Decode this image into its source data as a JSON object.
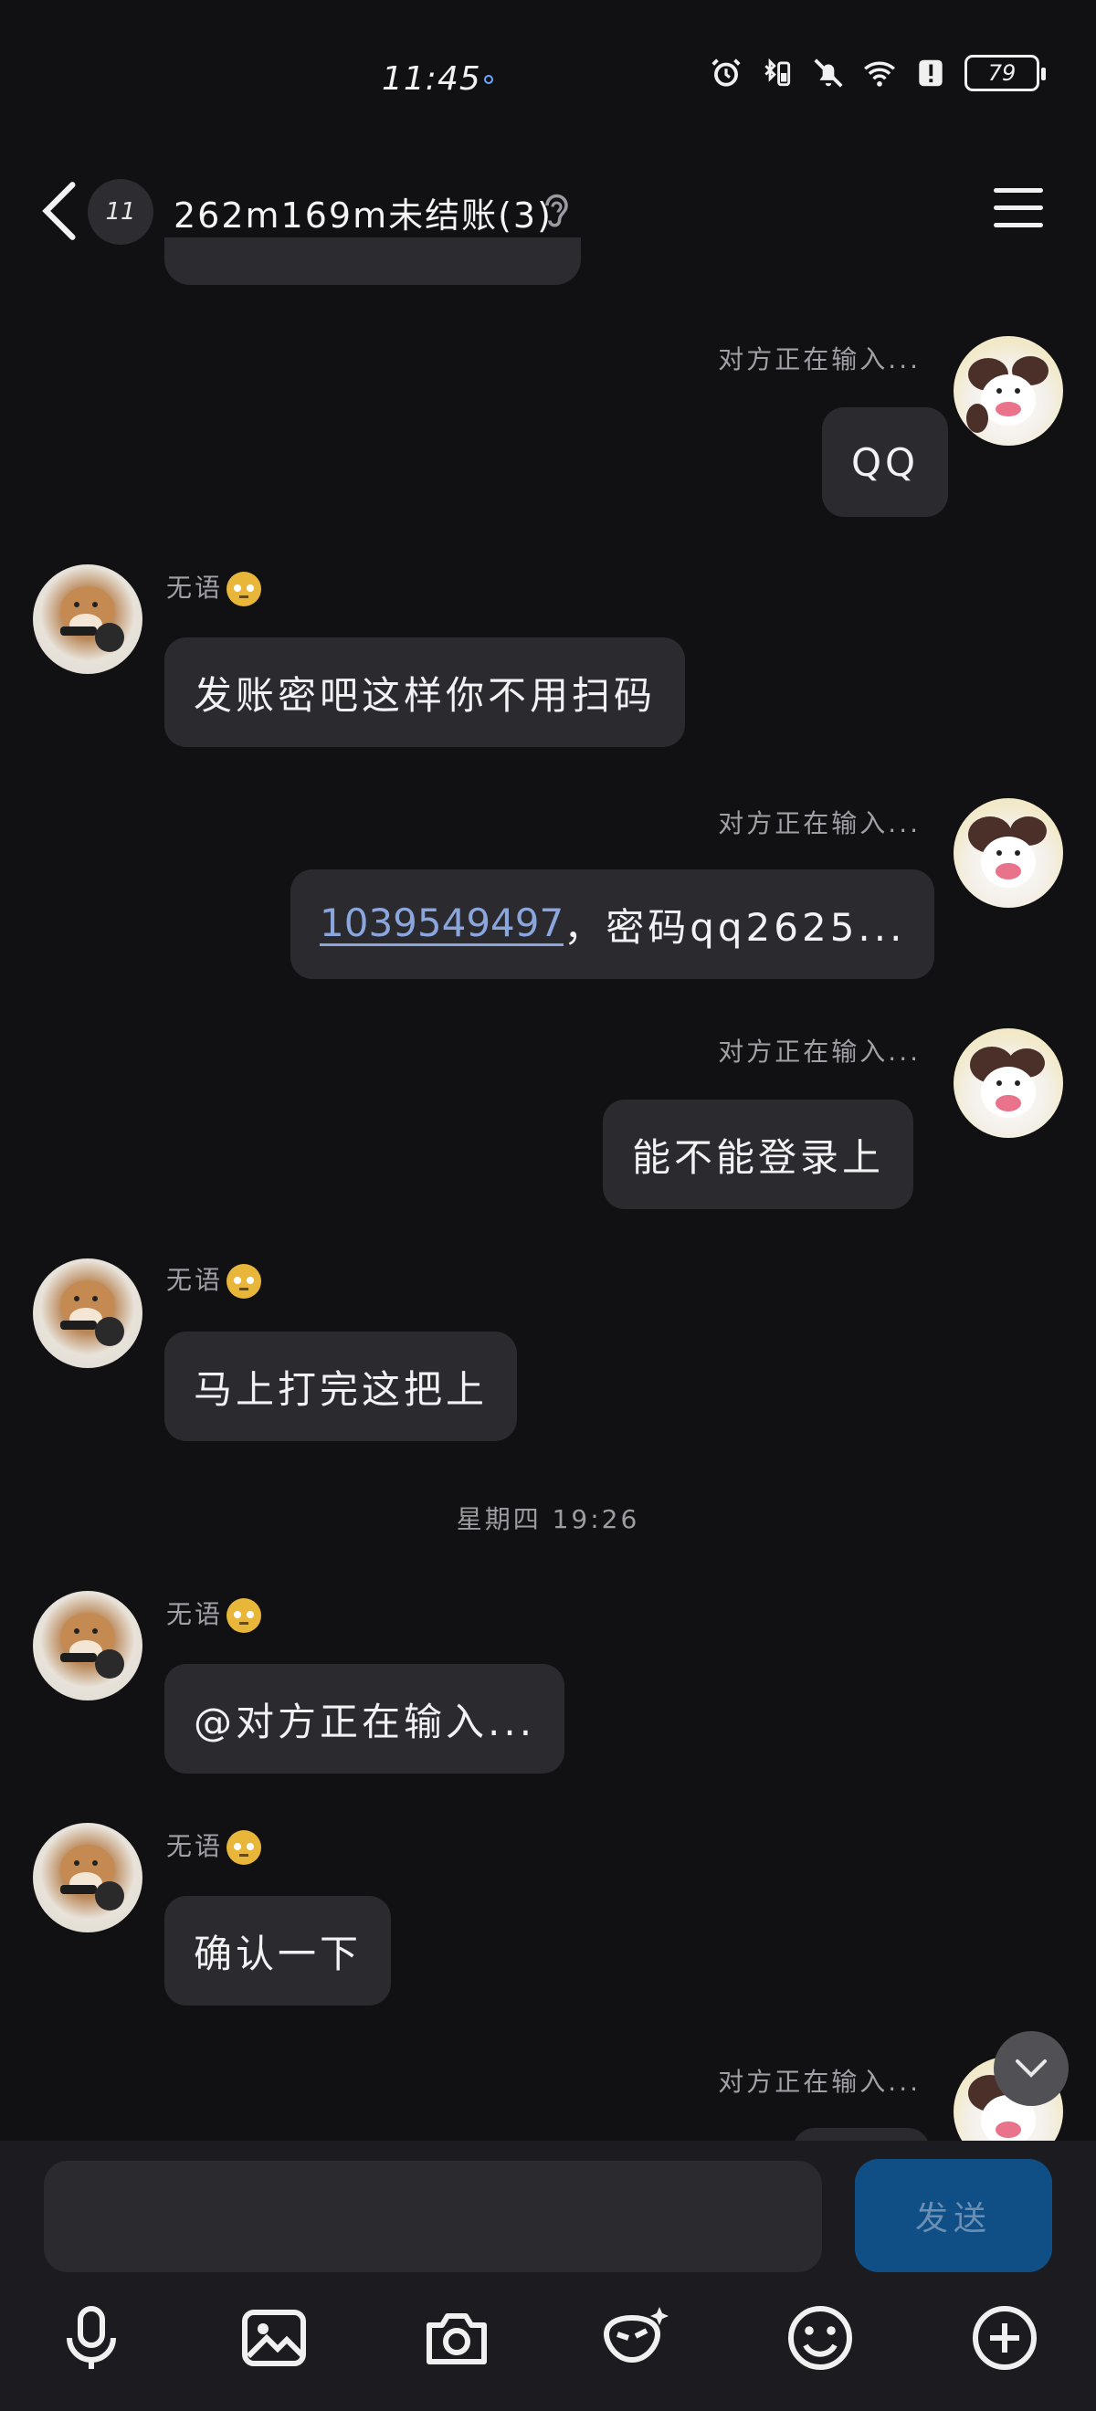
{
  "status": {
    "time": "11:45",
    "battery": "79"
  },
  "header": {
    "unread_count": "11",
    "title": "262m169m未结账(3)"
  },
  "messages": [
    {
      "side": "right",
      "nick": "对方正在输入...",
      "text": "QQ"
    },
    {
      "side": "left",
      "nick": "无语",
      "text": "发账密吧这样你不用扫码"
    },
    {
      "side": "right",
      "nick": "对方正在输入...",
      "link": "1039549497",
      "text": "，密码qq2625..."
    },
    {
      "side": "right",
      "nick": "对方正在输入...",
      "text": "能不能登录上"
    },
    {
      "side": "left",
      "nick": "无语",
      "text": "马上打完这把上"
    },
    {
      "side": "left",
      "nick": "无语",
      "text": "@对方正在输入..."
    },
    {
      "side": "left",
      "nick": "无语",
      "text": "确认一下"
    },
    {
      "side": "right",
      "nick": "对方正在输入..."
    }
  ],
  "timestamp": "星期四 19:26",
  "composer": {
    "placeholder": "",
    "send_label": "发送"
  },
  "toolbar": [
    "microphone-icon",
    "image-icon",
    "camera-icon",
    "sticker-icon",
    "emoji-icon",
    "plus-icon"
  ]
}
